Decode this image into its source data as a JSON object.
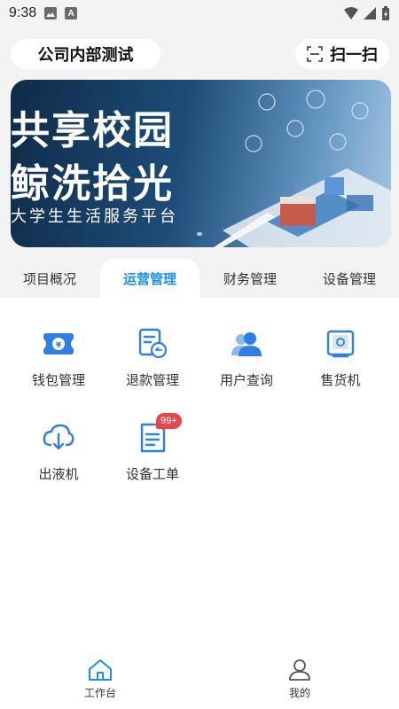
{
  "status_bar": {
    "time": "9:38",
    "icons": [
      "image-icon",
      "a-notification-icon",
      "wifi-icon",
      "signal-icon",
      "battery-charging-icon"
    ]
  },
  "header": {
    "company_name": "公司内部测试",
    "scan_label": "扫一扫",
    "scan_icon": "scan-icon"
  },
  "banner": {
    "title_line1": "共享校园",
    "title_line2": "鲸洗拾光",
    "subtitle": "大学生生活服务平台"
  },
  "tabs": [
    {
      "label": "项目概况",
      "active": false
    },
    {
      "label": "运营管理",
      "active": true
    },
    {
      "label": "财务管理",
      "active": false
    },
    {
      "label": "设备管理",
      "active": false
    }
  ],
  "grid": [
    {
      "label": "钱包管理",
      "icon": "wallet-icon"
    },
    {
      "label": "退款管理",
      "icon": "refund-icon"
    },
    {
      "label": "用户查询",
      "icon": "users-icon"
    },
    {
      "label": "售货机",
      "icon": "vending-machine-icon"
    },
    {
      "label": "出液机",
      "icon": "liquid-dispenser-icon"
    },
    {
      "label": "设备工单",
      "icon": "work-order-icon",
      "badge": "99+"
    }
  ],
  "bottom_nav": [
    {
      "label": "工作台",
      "icon": "home-icon",
      "active": true
    },
    {
      "label": "我的",
      "icon": "user-icon",
      "active": false
    }
  ],
  "colors": {
    "accent": "#1a8ff0",
    "badge": "#e84848",
    "background": "#f3f3f3"
  }
}
